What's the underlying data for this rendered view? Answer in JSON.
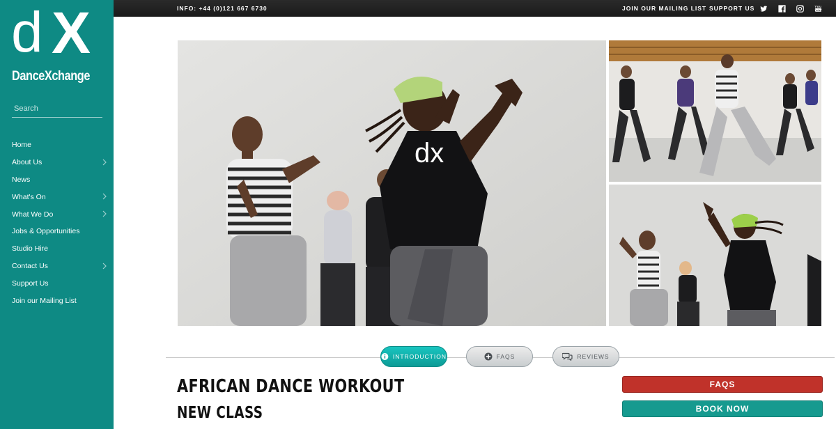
{
  "brand": {
    "logo_d": "d",
    "logo_x": "X",
    "name": "DanceXchange",
    "color": "#0e8a84"
  },
  "search": {
    "placeholder": "Search",
    "value": ""
  },
  "nav": [
    {
      "label": "Home",
      "has_submenu": false
    },
    {
      "label": "About Us",
      "has_submenu": true
    },
    {
      "label": "News",
      "has_submenu": false
    },
    {
      "label": "What's On",
      "has_submenu": true
    },
    {
      "label": "What We Do",
      "has_submenu": true
    },
    {
      "label": "Jobs & Opportunities",
      "has_submenu": false
    },
    {
      "label": "Studio Hire",
      "has_submenu": false
    },
    {
      "label": "Contact Us",
      "has_submenu": true
    },
    {
      "label": "Support Us",
      "has_submenu": false
    },
    {
      "label": "Join our Mailing List",
      "has_submenu": false
    }
  ],
  "topbar": {
    "info": "INFO: +44 (0)121 667 6730",
    "mailing": "JOIN OUR MAILING LIST",
    "support": "SUPPORT US",
    "social": [
      "twitter-icon",
      "facebook-icon",
      "instagram-icon",
      "youtube-icon"
    ]
  },
  "tabs": [
    {
      "label": "INTRODUCTION",
      "icon": "info-icon",
      "active": true
    },
    {
      "label": "FAQS",
      "icon": "plus-icon",
      "active": false
    },
    {
      "label": "REVIEWS",
      "icon": "speech-bubbles-icon",
      "active": false
    }
  ],
  "event": {
    "title": "AFRICAN DANCE WORKOUT",
    "subtitle": "NEW CLASS"
  },
  "actions": {
    "faqs": "FAQS",
    "book_now": "BOOK NOW",
    "faqs_color": "#c0322a",
    "book_color": "#169a8f"
  }
}
